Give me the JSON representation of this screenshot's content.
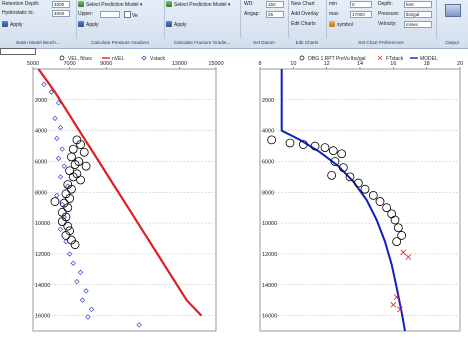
{
  "ribbon": {
    "groups": [
      {
        "caption": "Basin Model Bench..."
      },
      {
        "caption": "Calculate Pressure Gradient"
      },
      {
        "caption": "Calculate Fracture Gradie..."
      },
      {
        "caption": "Set Datum"
      },
      {
        "caption": "Edit Charts"
      },
      {
        "caption": "Set Chart Preferences"
      },
      {
        "caption": "Output"
      }
    ],
    "retention_depth_label": "Retention Depth:",
    "retention_depth_value": "4000",
    "hydrostatic_label": "Hydrostatic to:",
    "hydrostatic_value": "4000",
    "apply1": "Apply",
    "select_prediction_model": "Select Prediction Model",
    "upper_label": "Upper:",
    "ve_label": "Ve",
    "apply2": "Apply",
    "select_pred_model2": "Select Prediction Model",
    "apply3": "Apply",
    "wd_label": "WD:",
    "wd_value": "150",
    "airgap_label": "Airgap:",
    "airgap_value": "25",
    "new_chart": "New Chart",
    "add_overlay": "Add Overlay",
    "edit_charts": "Edit Charts",
    "min_label": "min",
    "min_value": "0",
    "max_label": "max",
    "max_value": "17000",
    "symbol_label": "symbol",
    "symbol_value": "",
    "depth_label": "Depth:",
    "depth_value": "feet",
    "pressure_label": "Pressure:",
    "pressure_value": "lbs/gal",
    "velocity_label": "Velocity:",
    "velocity_value": "m/sec",
    "output_label": "Output"
  },
  "left_chart": {
    "legend": [
      "VEL, ft/sec",
      "nVEL",
      "Vstack"
    ],
    "colors": {
      "vel": "#000000",
      "nvel": "#e02020",
      "vstack": "#2030c0"
    },
    "chart_data": {
      "type": "scatter",
      "x_ticks": [
        "5000",
        "7000",
        "9000",
        "13000",
        "15000"
      ],
      "y_ticks": [
        "2000",
        "4000",
        "6000",
        "8000",
        "10000",
        "12000",
        "14000",
        "16000"
      ],
      "xlim": [
        5000,
        15000
      ],
      "ylim": [
        0,
        17000
      ],
      "y_reversed": true,
      "series": [
        {
          "name": "nVEL",
          "kind": "line",
          "points": [
            [
              5300,
              0
            ],
            [
              6200,
              1500
            ],
            [
              7000,
              3000
            ],
            [
              7800,
              4500
            ],
            [
              8600,
              6000
            ],
            [
              9400,
              7500
            ],
            [
              10200,
              9000
            ],
            [
              11000,
              10500
            ],
            [
              11800,
              12000
            ],
            [
              12600,
              13500
            ],
            [
              13400,
              15000
            ],
            [
              14200,
              16000
            ]
          ]
        },
        {
          "name": "VEL, ft/sec",
          "kind": "markers",
          "points": [
            [
              7400,
              4600
            ],
            [
              7600,
              4900
            ],
            [
              7200,
              5200
            ],
            [
              7800,
              5400
            ],
            [
              7100,
              5700
            ],
            [
              7500,
              6000
            ],
            [
              7300,
              6200
            ],
            [
              7900,
              6300
            ],
            [
              7000,
              6600
            ],
            [
              7400,
              6800
            ],
            [
              7200,
              7000
            ],
            [
              7600,
              7200
            ],
            [
              6900,
              7500
            ],
            [
              7100,
              7800
            ],
            [
              6800,
              8100
            ],
            [
              7000,
              8400
            ],
            [
              6700,
              8700
            ],
            [
              6900,
              9000
            ],
            [
              6600,
              9300
            ],
            [
              6800,
              9600
            ],
            [
              6600,
              9900
            ],
            [
              6900,
              10200
            ],
            [
              7000,
              10500
            ],
            [
              6800,
              10800
            ],
            [
              7100,
              11100
            ],
            [
              7300,
              11400
            ],
            [
              6200,
              8600
            ]
          ]
        },
        {
          "name": "Vstack",
          "kind": "markers",
          "points": [
            [
              5600,
              1000
            ],
            [
              6000,
              1500
            ],
            [
              6400,
              2200
            ],
            [
              6200,
              3200
            ],
            [
              6500,
              3800
            ],
            [
              6300,
              4500
            ],
            [
              6600,
              5200
            ],
            [
              6400,
              5800
            ],
            [
              6700,
              6300
            ],
            [
              6500,
              7000
            ],
            [
              6900,
              7600
            ],
            [
              6300,
              8200
            ],
            [
              6600,
              8800
            ],
            [
              6700,
              9600
            ],
            [
              6500,
              10400
            ],
            [
              6800,
              11200
            ],
            [
              7000,
              12000
            ],
            [
              7200,
              12600
            ],
            [
              7600,
              13200
            ],
            [
              7400,
              13800
            ],
            [
              7900,
              14400
            ],
            [
              7700,
              15000
            ],
            [
              8200,
              15600
            ],
            [
              8000,
              16100
            ],
            [
              10800,
              16600
            ]
          ]
        }
      ]
    }
  },
  "right_chart": {
    "legend": [
      "OBG 1.RPT  PreVu lbs/gal",
      "FTstack",
      "MODEL"
    ],
    "colors": {
      "obg": "#000000",
      "ftstack": "#e02020",
      "model": "#1020c0"
    },
    "chart_data": {
      "type": "scatter",
      "x_ticks": [
        "8",
        "10",
        "12",
        "14",
        "16",
        "18",
        "20"
      ],
      "y_ticks": [
        "2000",
        "4000",
        "6000",
        "8000",
        "10000",
        "12000",
        "14000",
        "16000"
      ],
      "xlim": [
        8,
        20
      ],
      "ylim": [
        0,
        17000
      ],
      "y_reversed": true,
      "series": [
        {
          "name": "MODEL",
          "kind": "line",
          "points": [
            [
              9.3,
              0
            ],
            [
              9.3,
              4000
            ],
            [
              10.4,
              4600
            ],
            [
              11.6,
              5400
            ],
            [
              12.7,
              6300
            ],
            [
              13.6,
              7300
            ],
            [
              14.4,
              8500
            ],
            [
              15.0,
              9800
            ],
            [
              15.5,
              11200
            ],
            [
              15.9,
              12700
            ],
            [
              16.2,
              14200
            ],
            [
              16.5,
              15800
            ],
            [
              16.7,
              17000
            ]
          ]
        },
        {
          "name": "OBG 1.RPT  PreVu lbs/gal",
          "kind": "markers",
          "points": [
            [
              8.7,
              4600
            ],
            [
              9.8,
              4800
            ],
            [
              10.6,
              4900
            ],
            [
              11.3,
              5000
            ],
            [
              11.9,
              5100
            ],
            [
              12.4,
              5300
            ],
            [
              12.9,
              5500
            ],
            [
              12.5,
              6000
            ],
            [
              13.0,
              6400
            ],
            [
              12.3,
              6900
            ],
            [
              13.4,
              7000
            ],
            [
              13.9,
              7400
            ],
            [
              14.3,
              7800
            ],
            [
              14.8,
              8200
            ],
            [
              15.2,
              8600
            ],
            [
              15.6,
              9000
            ],
            [
              15.9,
              9400
            ],
            [
              16.1,
              9800
            ],
            [
              16.3,
              10300
            ],
            [
              16.5,
              10800
            ],
            [
              16.2,
              11200
            ]
          ]
        },
        {
          "name": "FTstack",
          "kind": "markers",
          "points": [
            [
              16.6,
              11900
            ],
            [
              16.9,
              12200
            ],
            [
              16.2,
              14800
            ],
            [
              16.0,
              15300
            ],
            [
              16.4,
              15600
            ]
          ]
        }
      ]
    }
  }
}
